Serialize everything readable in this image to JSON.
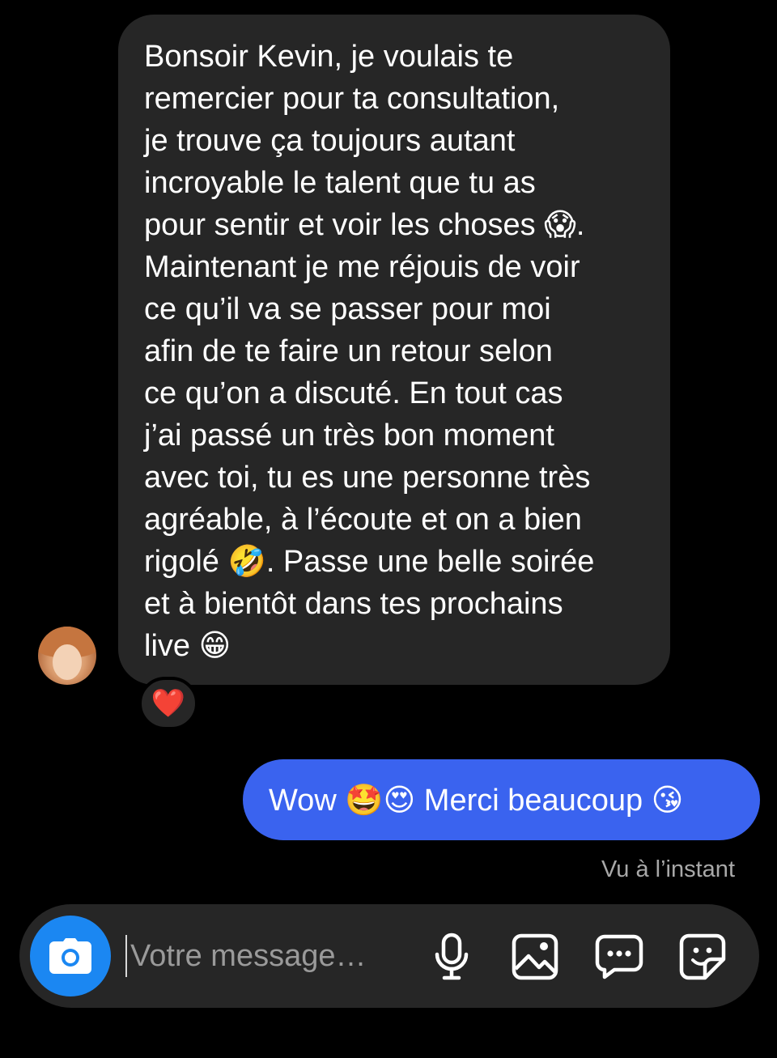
{
  "conversation": {
    "incoming_message": {
      "text": "Bonsoir Kevin, je voulais te\nremercier pour ta consultation,\nje trouve ça toujours autant\nincroyable le talent que tu as\npour sentir et voir les choses 😱.\nMaintenant je me réjouis de voir\nce qu’il va se passer pour moi\nafin de te faire un retour selon\nce qu’on a discuté. En tout cas\nj’ai passé un très bon moment\navec toi, tu es une personne très\nagréable, à l’écoute et on a bien\nrigolé 🤣. Passe une belle soirée\net à bientôt dans tes prochains\nlive 😁",
      "reaction": "❤️"
    },
    "outgoing_message": {
      "text": "Wow 🤩😍 Merci beaucoup 😘"
    },
    "seen_status": "Vu à l’instant"
  },
  "composer": {
    "placeholder": "Votre message…",
    "icons": {
      "camera": "camera-icon",
      "mic": "microphone-icon",
      "gallery": "image-icon",
      "chat": "chat-bubble-icon",
      "sticker": "sticker-icon"
    }
  },
  "colors": {
    "background": "#000000",
    "incoming_bubble": "#262626",
    "outgoing_bubble": "#3a63ef",
    "camera_button": "#1b87f2",
    "muted_text": "#a8a8a8"
  }
}
